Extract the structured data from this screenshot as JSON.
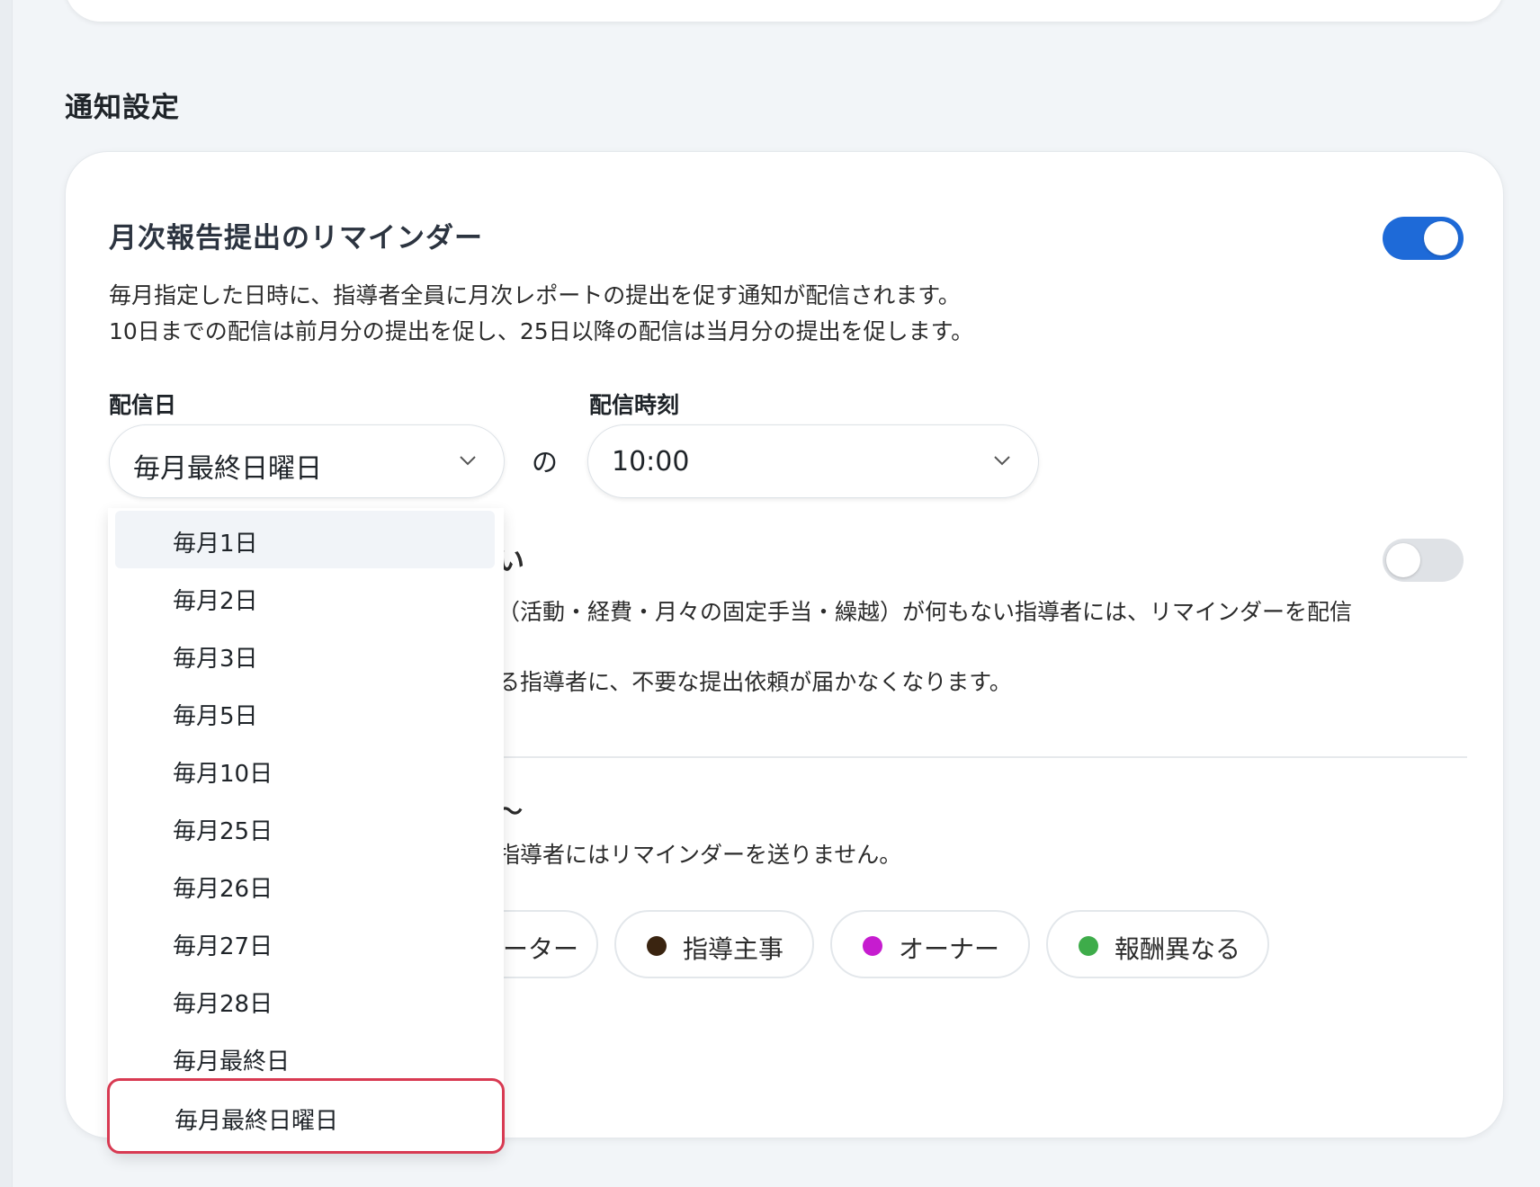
{
  "section": {
    "title": "通知設定"
  },
  "reminder": {
    "title": "月次報告提出のリマインダー",
    "enabled": true,
    "description_line1": "毎月指定した日時に、指導者全員に月次レポートの提出を促す通知が配信されます。",
    "description_line2": "10日までの配信は前月分の提出を促し、25日以降の配信は当月分の提出を促します。",
    "day_label": "配信日",
    "day_value": "毎月最終日曜日",
    "connector": "の",
    "time_label": "配信時刻",
    "time_value": "10:00"
  },
  "second_setting": {
    "title_fragment": "い",
    "enabled": false,
    "desc_line1": "（活動・経費・月々の固定手当・繰越）が何もない指導者には、リマインダーを配信",
    "desc_line2": "る指導者に、不要な提出依頼が届かなくなります。"
  },
  "third_setting": {
    "title_fragment": "〜",
    "desc": "指導者にはリマインダーを送りません。",
    "chips": [
      {
        "label": "ーター",
        "color": ""
      },
      {
        "label": "指導主事",
        "color": "#3a2410"
      },
      {
        "label": "オーナー",
        "color": "#c61ccf"
      },
      {
        "label": "報酬異なる",
        "color": "#3eac4a"
      }
    ]
  },
  "dropdown": {
    "options": [
      "毎月1日",
      "毎月2日",
      "毎月3日",
      "毎月5日",
      "毎月10日",
      "毎月25日",
      "毎月26日",
      "毎月27日",
      "毎月28日",
      "毎月最終日",
      "毎月最終日曜日"
    ],
    "highlighted": "毎月1日",
    "selected": "毎月最終日曜日"
  },
  "colors": {
    "accent": "#1e6ad8",
    "outline": "#d83a52"
  }
}
